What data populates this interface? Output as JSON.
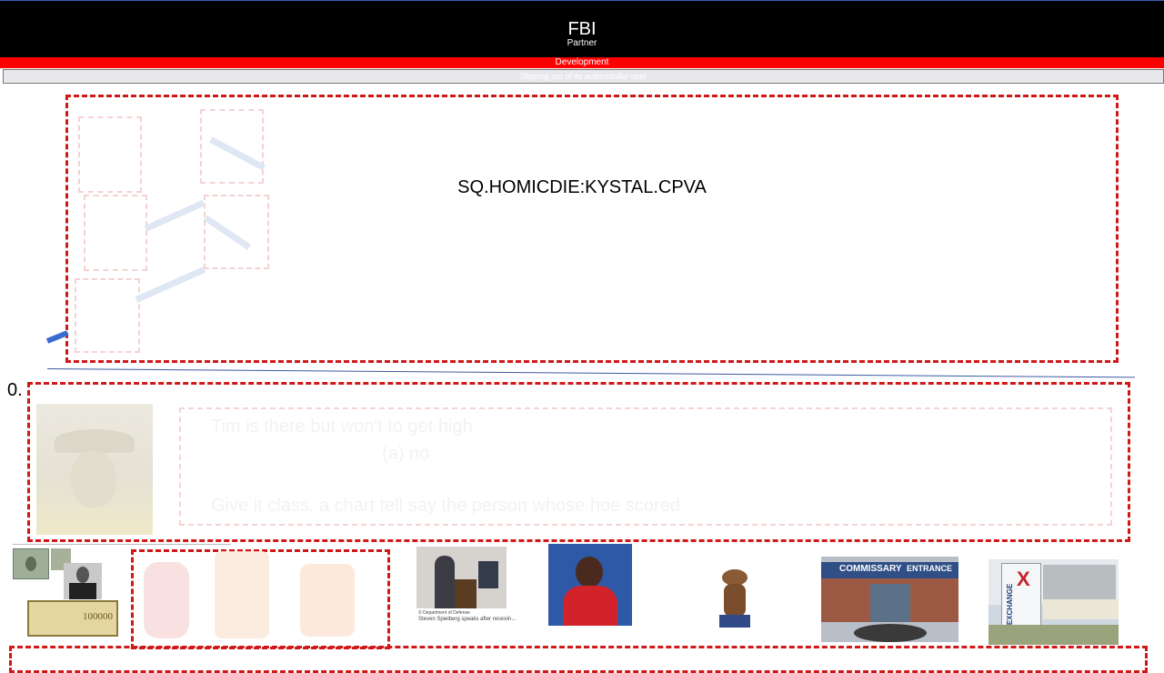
{
  "header": {
    "title": "FBI",
    "subtitle": "Partner",
    "bar_label": "Development",
    "notice": "Slipping out of its action/dollar user"
  },
  "main_panel": {
    "label": "SQ.HOMICDIE:KYSTAL.CPVA"
  },
  "section": {
    "index_label": "0.",
    "faint_line_1": "Tim is there but won't to get high",
    "faint_line_2": "(a) no",
    "faint_line_3": "Give it class, a chart tell say the person whose hoe scored"
  },
  "thumbnails": {
    "spielberg_caption_source": "© Department of Defense",
    "spielberg_caption": "Steven Spielberg speaks after receivin...",
    "commissary_sign": "COMMISSARY",
    "entrance_sign": "ENTRANCE",
    "exchange_sign": "EXCHANGE",
    "banknote_value": "100000"
  },
  "colors": {
    "header_bg": "#000000",
    "accent_red": "#ff0000",
    "dashed_red": "#d01818",
    "divider_blue": "#3b5aa0"
  }
}
